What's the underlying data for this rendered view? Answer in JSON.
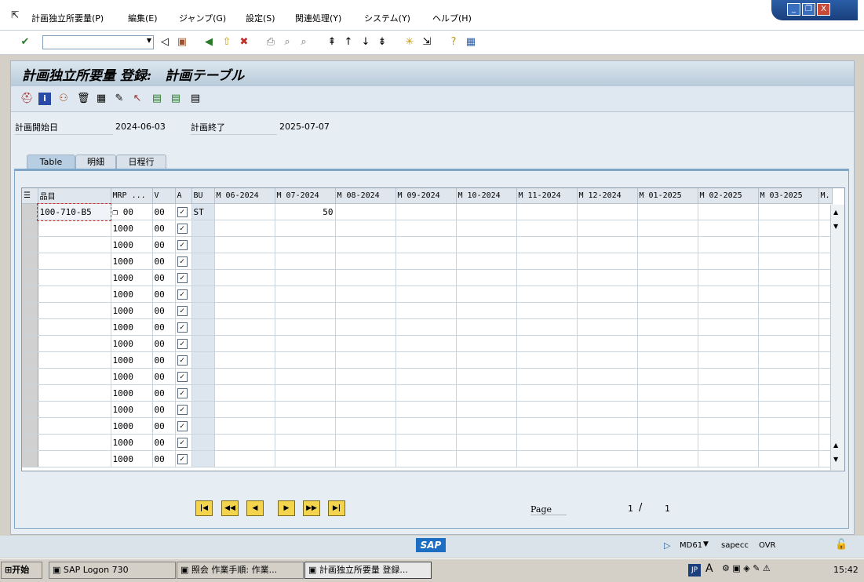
{
  "menu": {
    "items": [
      "計画独立所要量(P)",
      "編集(E)",
      "ジャンプ(G)",
      "設定(S)",
      "関連処理(Y)",
      "システム(Y)",
      "ヘルプ(H)"
    ]
  },
  "window": {
    "minimize": "_",
    "restore": "❐",
    "close": "X"
  },
  "screen": {
    "title": "計画独立所要量 登録:　計画テーブル"
  },
  "fields": {
    "plan_start_label": "計画開始日",
    "plan_start_value": "2024-06-03",
    "plan_end_label": "計画終了",
    "plan_end_value": "2025-07-07"
  },
  "tabs": [
    "Table",
    "明細",
    "日程行"
  ],
  "grid": {
    "headers": [
      "品目",
      "MRP ...",
      "V",
      "A",
      "BU",
      "M 06-2024",
      "M 07-2024",
      "M 08-2024",
      "M 09-2024",
      "M 10-2024",
      "M 11-2024",
      "M 12-2024",
      "M 01-2025",
      "M 02-2025",
      "M 03-2025",
      "M."
    ],
    "first_row": {
      "material": "100-710-B5",
      "mrp": "00",
      "v": "00",
      "a_checked": true,
      "bu": "ST",
      "m07": "50"
    },
    "other_rows": [
      {
        "mrp": "1000",
        "v": "00"
      },
      {
        "mrp": "1000",
        "v": "00"
      },
      {
        "mrp": "1000",
        "v": "00"
      },
      {
        "mrp": "1000",
        "v": "00"
      },
      {
        "mrp": "1000",
        "v": "00"
      },
      {
        "mrp": "1000",
        "v": "00"
      },
      {
        "mrp": "1000",
        "v": "00"
      },
      {
        "mrp": "1000",
        "v": "00"
      },
      {
        "mrp": "1000",
        "v": "00"
      },
      {
        "mrp": "1000",
        "v": "00"
      },
      {
        "mrp": "1000",
        "v": "00"
      },
      {
        "mrp": "1000",
        "v": "00"
      },
      {
        "mrp": "1000",
        "v": "00"
      },
      {
        "mrp": "1000",
        "v": "00"
      },
      {
        "mrp": "1000",
        "v": "00"
      }
    ]
  },
  "paging": {
    "page_label": "Page",
    "current": "1",
    "separator": "/",
    "total": "1"
  },
  "status": {
    "sap_logo": "SAP",
    "transaction": "MD61",
    "system": "sapecc",
    "mode": "OVR"
  },
  "taskbar": {
    "start": "开始",
    "tasks": [
      "SAP Logon 730",
      "照会 作業手順: 作業...",
      "計画独立所要量 登録..."
    ],
    "ime": "JP",
    "clock": "15:42"
  }
}
